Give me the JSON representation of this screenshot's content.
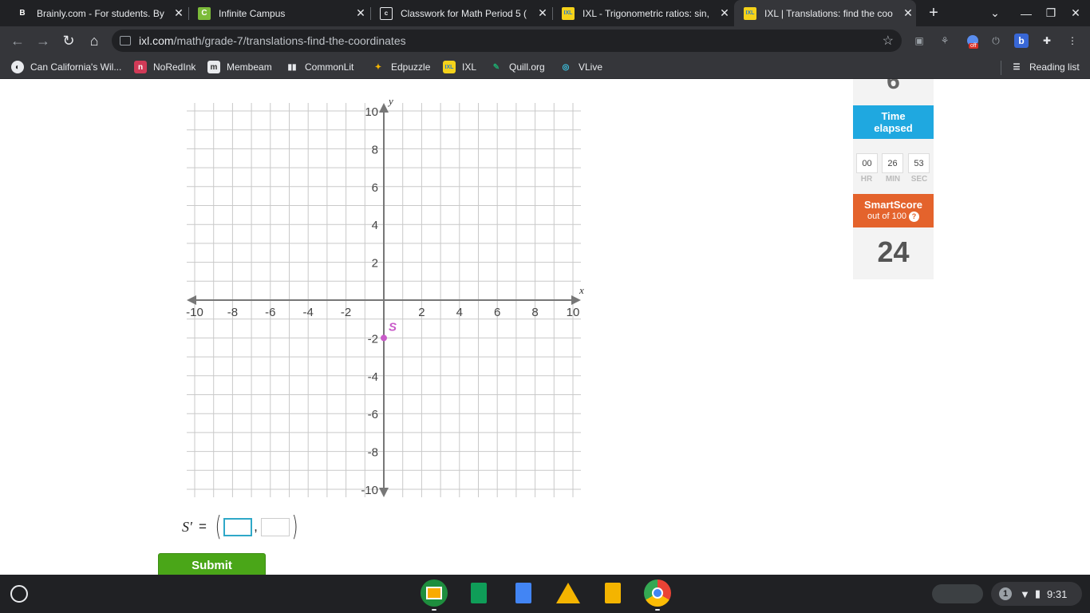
{
  "browser": {
    "tabs": [
      {
        "title": "Brainly.com - For students. By",
        "fav": "B"
      },
      {
        "title": "Infinite Campus",
        "fav": "C"
      },
      {
        "title": "Classwork for Math Period 5 (",
        "fav": "c"
      },
      {
        "title": "IXL - Trigonometric ratios: sin,",
        "fav": "IXL"
      },
      {
        "title": "IXL | Translations: find the coo",
        "fav": "IXL"
      }
    ],
    "url_host": "ixl.com",
    "url_path": "/math/grade-7/translations-find-the-coordinates",
    "bookmarks": [
      {
        "label": "Can California's Wil...",
        "icon": "globe-icon"
      },
      {
        "label": "NoRedInk",
        "icon": "n"
      },
      {
        "label": "Membeam",
        "icon": "m"
      },
      {
        "label": "CommonLit",
        "icon": "book"
      },
      {
        "label": "Edpuzzle",
        "icon": "e"
      },
      {
        "label": "IXL",
        "icon": "IXL"
      },
      {
        "label": "Quill.org",
        "icon": "q"
      },
      {
        "label": "VLive",
        "icon": "v"
      }
    ],
    "reading_list": "Reading list",
    "ext_badge": "off"
  },
  "side_panel": {
    "question_number": "6",
    "time_label_1": "Time",
    "time_label_2": "elapsed",
    "hours": "00",
    "minutes": "26",
    "seconds": "53",
    "hr_label": "HR",
    "min_label": "MIN",
    "sec_label": "SEC",
    "smartscore_title": "SmartScore",
    "smartscore_sub": "out of 100",
    "help": "?",
    "score": "24"
  },
  "graph": {
    "xlabel": "x",
    "ylabel": "y",
    "range": [
      -10,
      10
    ],
    "x_ticks": [
      "-10",
      "-8",
      "-6",
      "-4",
      "-2",
      "2",
      "4",
      "6",
      "8",
      "10"
    ],
    "y_ticks": [
      "10",
      "8",
      "6",
      "4",
      "2",
      "-2",
      "-4",
      "-6",
      "-8",
      "-10"
    ],
    "point": {
      "label": "S",
      "x": 0,
      "y": -2,
      "color": "#c95bc9"
    }
  },
  "answer": {
    "label": "S′",
    "equals": "=",
    "comma": ","
  },
  "submit_label": "Submit",
  "shelf": {
    "time": "9:31",
    "notifications": "1"
  }
}
